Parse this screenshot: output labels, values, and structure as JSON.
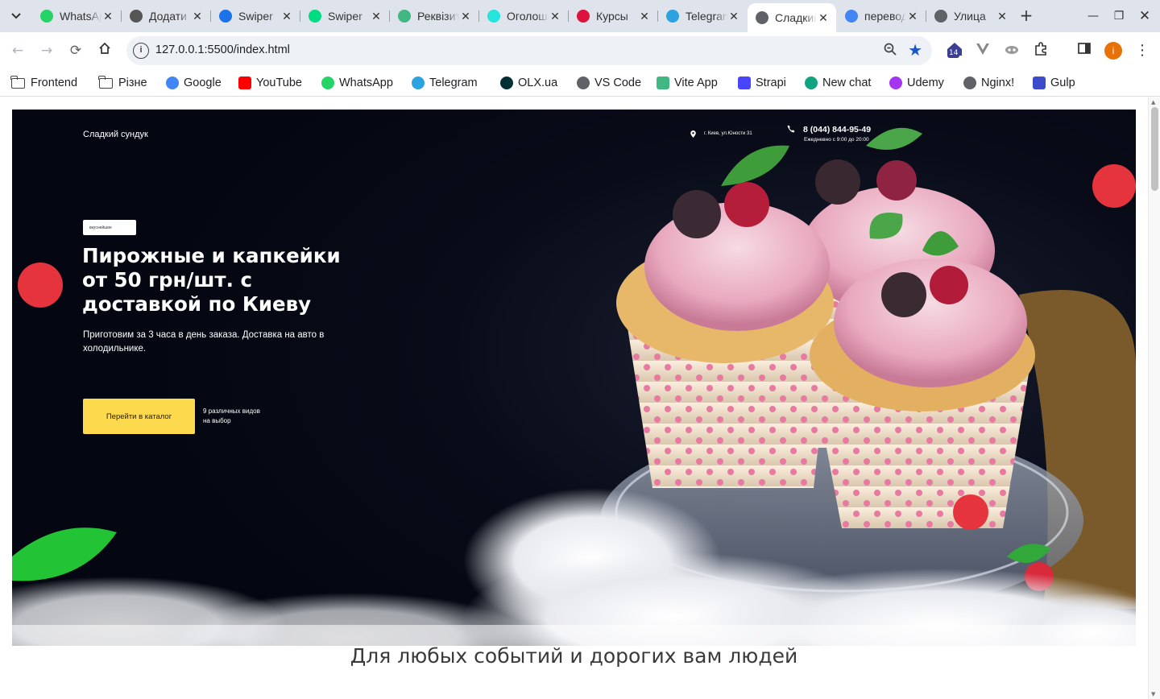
{
  "browser": {
    "tabs": [
      {
        "label": "WhatsApp",
        "icon": "whatsapp-icon",
        "color": "#25d366"
      },
      {
        "label": "Додати",
        "icon": "openai-icon",
        "color": "#555555"
      },
      {
        "label": "Swiper",
        "icon": "swiper-icon",
        "color": "#1a73e8"
      },
      {
        "label": "Swiper",
        "icon": "nuxt-icon",
        "color": "#00dc82"
      },
      {
        "label": "Реквізити",
        "icon": "vue-icon",
        "color": "#41b883"
      },
      {
        "label": "Оголошення",
        "icon": "olx-icon",
        "color": "#23e5db"
      },
      {
        "label": "Курсы",
        "icon": "poland-flag-icon",
        "color": "#dc143c"
      },
      {
        "label": "Telegram",
        "icon": "telegram-icon",
        "color": "#2aa3e0"
      },
      {
        "label": "Сладкий",
        "icon": "globe-icon",
        "color": "#5f6368",
        "active": true
      },
      {
        "label": "перевод",
        "icon": "google-icon",
        "color": "#4285f4"
      },
      {
        "label": "Улица",
        "icon": "search-doc-icon",
        "color": "#5f6368"
      }
    ],
    "url": "127.0.0.1:5500/index.html",
    "extension_badge": "14",
    "profile_initial": "i",
    "bookmarks": [
      {
        "label": "Frontend",
        "icon": "folder-icon"
      },
      {
        "label": "Різне",
        "icon": "folder-icon"
      },
      {
        "label": "Google",
        "icon": "google-icon",
        "color": "#4285f4"
      },
      {
        "label": "YouTube",
        "icon": "youtube-icon",
        "color": "#ff0000"
      },
      {
        "label": "WhatsApp",
        "icon": "whatsapp-icon",
        "color": "#25d366"
      },
      {
        "label": "Telegram",
        "icon": "telegram-icon",
        "color": "#2aa3e0"
      },
      {
        "label": "OLX.ua",
        "icon": "olx-icon",
        "color": "#002f34"
      },
      {
        "label": "VS Code",
        "icon": "globe-icon",
        "color": "#5f6368"
      },
      {
        "label": "Vite App",
        "icon": "vue-icon",
        "color": "#41b883"
      },
      {
        "label": "Strapi",
        "icon": "strapi-icon",
        "color": "#4945ff"
      },
      {
        "label": "New chat",
        "icon": "openai-icon",
        "color": "#10a37f"
      },
      {
        "label": "Udemy",
        "icon": "udemy-icon",
        "color": "#a435f0"
      },
      {
        "label": "Nginx!",
        "icon": "globe-icon",
        "color": "#5f6368"
      },
      {
        "label": "Gulp",
        "icon": "gulp-icon",
        "color": "#3b4bc9"
      }
    ]
  },
  "site": {
    "logo": "Сладкий сундук",
    "address": "г. Киев, ул.Юности 31",
    "phone": "8 (044) 844-95-49",
    "hours": "Ежедневно с 9:00 до 20:00",
    "badge": "вкуснейшие",
    "headline": "Пирожные и капкейки от 50 грн/шт. с доставкой по Киеву",
    "lead": "Приготовим за 3 часа в день заказа. Доставка на авто в холодильнике.",
    "cta": "Перейти в каталог",
    "cta_note": "9 различных видов на выбор",
    "section_title": "Для любых событий и дорогих вам людей",
    "accent": "#fdd94e"
  }
}
